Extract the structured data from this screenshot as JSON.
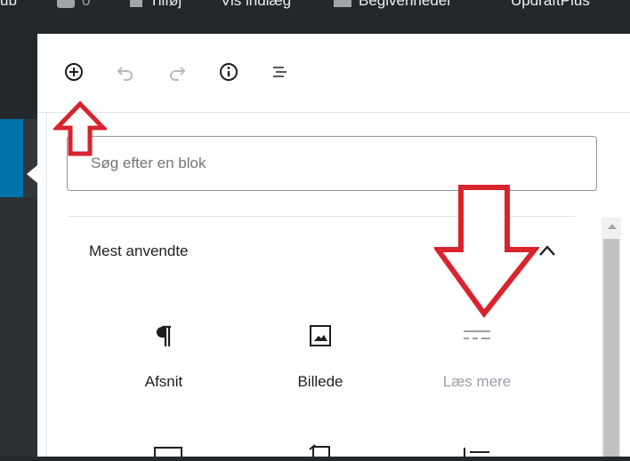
{
  "admin_bar": {
    "items": [
      "ub",
      "0",
      "Tilføj",
      "Vis indlæg",
      "Begivenheder",
      "UpdraftPlus"
    ]
  },
  "toolbar": {
    "buttons": [
      "add-block",
      "undo",
      "redo",
      "info",
      "outline"
    ]
  },
  "inserter": {
    "search_placeholder": "Søg efter en blok",
    "section_title": "Mest anvendte",
    "blocks": [
      {
        "label": "Afsnit",
        "icon": "paragraph-icon"
      },
      {
        "label": "Billede",
        "icon": "image-icon"
      },
      {
        "label": "Læs mere",
        "icon": "more-icon"
      }
    ]
  },
  "colors": {
    "admin_bg": "#23282d",
    "accent_blue": "#0073aa",
    "annotation_red": "#d9232d"
  }
}
